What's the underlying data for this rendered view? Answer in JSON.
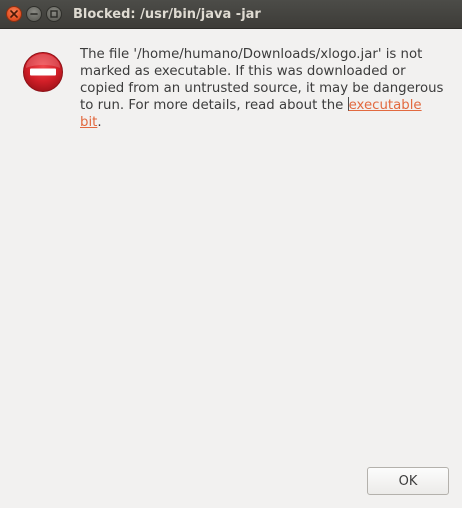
{
  "window": {
    "title": "Blocked: /usr/bin/java -jar"
  },
  "titlebar_buttons": {
    "close_icon": "close-icon",
    "minimize_icon": "minimize-icon",
    "maximize_icon": "maximize-icon"
  },
  "dialog": {
    "icon": "blocked-icon",
    "message_lines": [
      "The file '/home/humano/Downloads/xlogo.jar' is not",
      "marked as executable.  If this was downloaded or",
      "copied from an untrusted source, it may be dangerous",
      "to run.  For more details, read about the "
    ],
    "link_part1": "executable",
    "link_part2": "bit",
    "message_end": ".",
    "ok_label": "OK"
  },
  "colors": {
    "background": "#f2f1f0",
    "titlebar": "#3d3c38",
    "link": "#e2693f",
    "close_button": "#e9572a",
    "icon_red": "#d21f28"
  }
}
